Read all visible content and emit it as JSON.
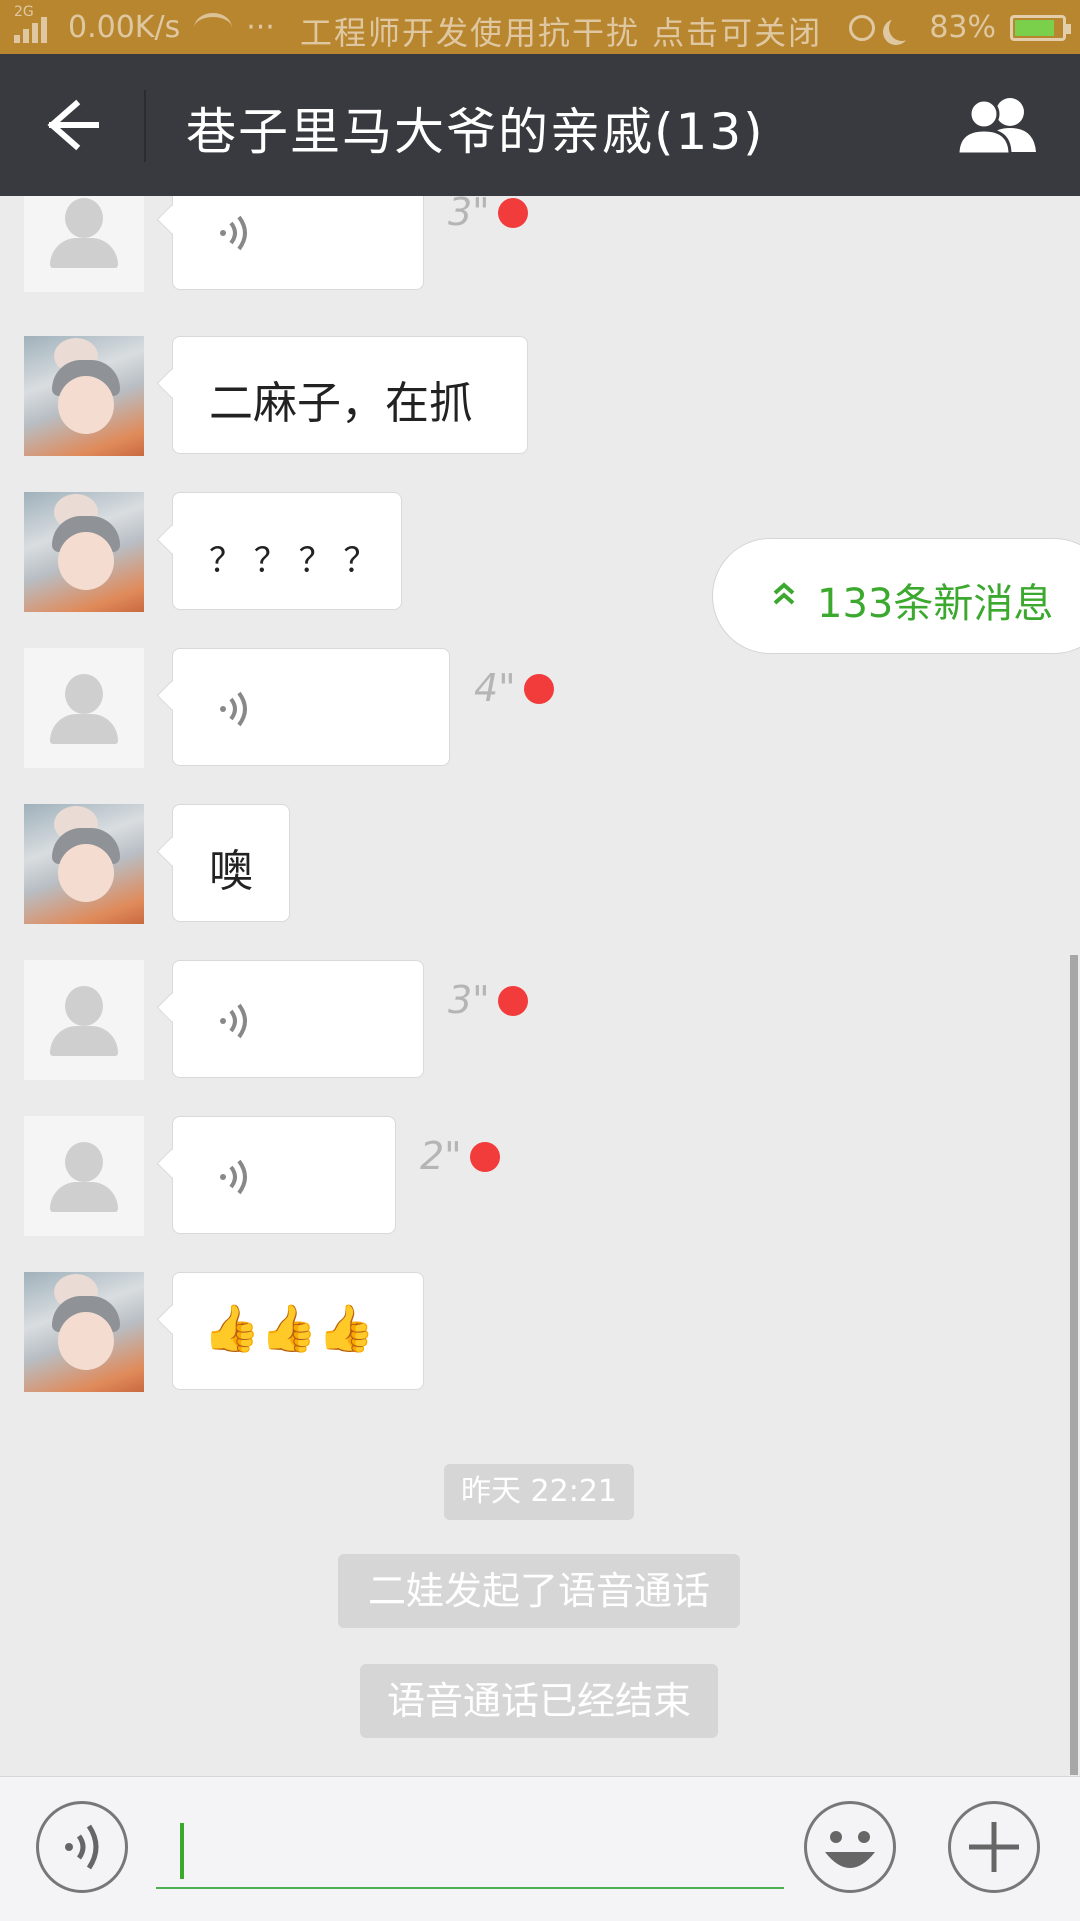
{
  "status_bar": {
    "network": "2G",
    "speed": "0.00K/s",
    "more": "···",
    "notice": "工程师开发使用抗干扰 点击可关闭",
    "battery": "83%"
  },
  "title_bar": {
    "title": "巷子里马大爷的亲戚(13)",
    "back_icon": "arrow-left-icon",
    "group_icon": "group-members-icon"
  },
  "messages": [
    {
      "type": "voice",
      "avatar": "default",
      "duration": "3\"",
      "unread": true
    },
    {
      "type": "text",
      "avatar": "photo",
      "text": "二麻子，在抓"
    },
    {
      "type": "text",
      "avatar": "photo",
      "text": "？ ？ ？ ？"
    },
    {
      "type": "voice",
      "avatar": "default",
      "duration": "4\"",
      "unread": true
    },
    {
      "type": "text",
      "avatar": "photo",
      "text": "噢"
    },
    {
      "type": "voice",
      "avatar": "default",
      "duration": "3\"",
      "unread": true
    },
    {
      "type": "voice",
      "avatar": "default",
      "duration": "2\"",
      "unread": true
    },
    {
      "type": "emoji",
      "avatar": "photo",
      "text": "👍👍👍"
    }
  ],
  "new_messages_pill": {
    "label": "133条新消息",
    "icon": "double-chevron-up-icon"
  },
  "system": {
    "timestamp": "昨天 22:21",
    "call_started": "二娃发起了语音通话",
    "call_ended": "语音通话已经结束"
  },
  "input_bar": {
    "voice_icon": "voice-mode-icon",
    "text_value": "",
    "emoji_icon": "smiley-face-icon",
    "add_icon": "plus-icon"
  },
  "colors": {
    "status_bar": "#b8862f",
    "title_bar": "#393a3f",
    "chat_bg": "#ebebeb",
    "accent_green": "#3ba82e",
    "unread_dot": "#f23b3b"
  }
}
